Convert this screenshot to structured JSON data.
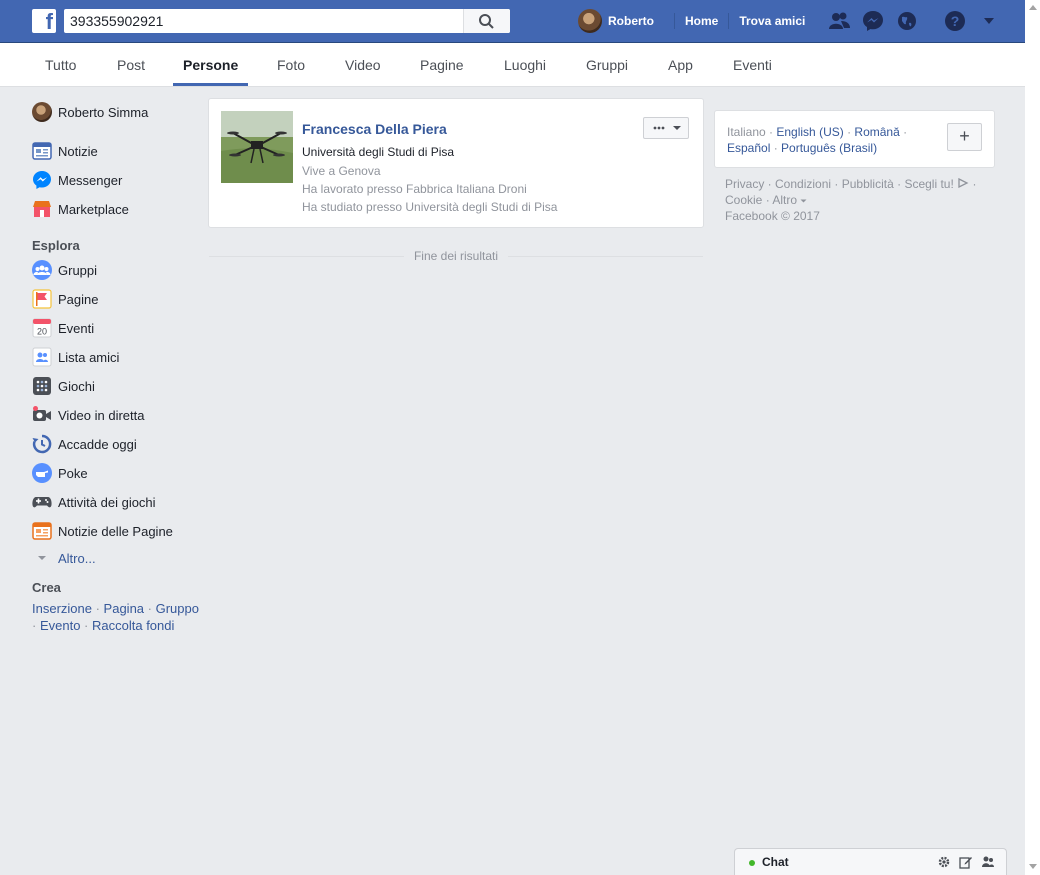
{
  "header": {
    "logo_letter": "f",
    "search_value": "393355902921",
    "user_name": "Roberto",
    "home_label": "Home",
    "find_friends_label": "Trova amici"
  },
  "tabs": [
    "Tutto",
    "Post",
    "Persone",
    "Foto",
    "Video",
    "Pagine",
    "Luoghi",
    "Gruppi",
    "App",
    "Eventi"
  ],
  "active_tab": "Persone",
  "sidebar": {
    "profile_name": "Roberto Simma",
    "top_items": [
      "Notizie",
      "Messenger",
      "Marketplace"
    ],
    "explore_title": "Esplora",
    "explore_items": [
      "Gruppi",
      "Pagine",
      "Eventi",
      "Lista amici",
      "Giochi",
      "Video in diretta",
      "Accadde oggi",
      "Poke",
      "Attività dei giochi",
      "Notizie delle Pagine"
    ],
    "more_label": "Altro...",
    "events_day": "20",
    "create_title": "Crea",
    "create_links": [
      "Inserzione",
      "Pagina",
      "Gruppo",
      "Evento",
      "Raccolta fondi"
    ]
  },
  "result": {
    "name": "Francesca Della Piera",
    "line1": "Università degli Studi di Pisa",
    "line2": "Vive a Genova",
    "line3": "Ha lavorato presso Fabbrica Italiana Droni",
    "line4": "Ha studiato presso Università degli Studi di Pisa"
  },
  "end_of_results": "Fine dei risultati",
  "languages": {
    "current": "Italiano",
    "options": [
      "English (US)",
      "Română",
      "Español",
      "Português (Brasil)"
    ],
    "add_label": "+"
  },
  "footer": {
    "links_line1": [
      "Privacy",
      "Condizioni",
      "Pubblicità",
      "Scegli tu!"
    ],
    "links_line2": [
      "Cookie",
      "Altro"
    ],
    "copyright": "Facebook © 2017"
  },
  "chat": {
    "label": "Chat"
  },
  "colors": {
    "brand": "#4267b2",
    "link": "#365899",
    "online": "#42b72a"
  }
}
